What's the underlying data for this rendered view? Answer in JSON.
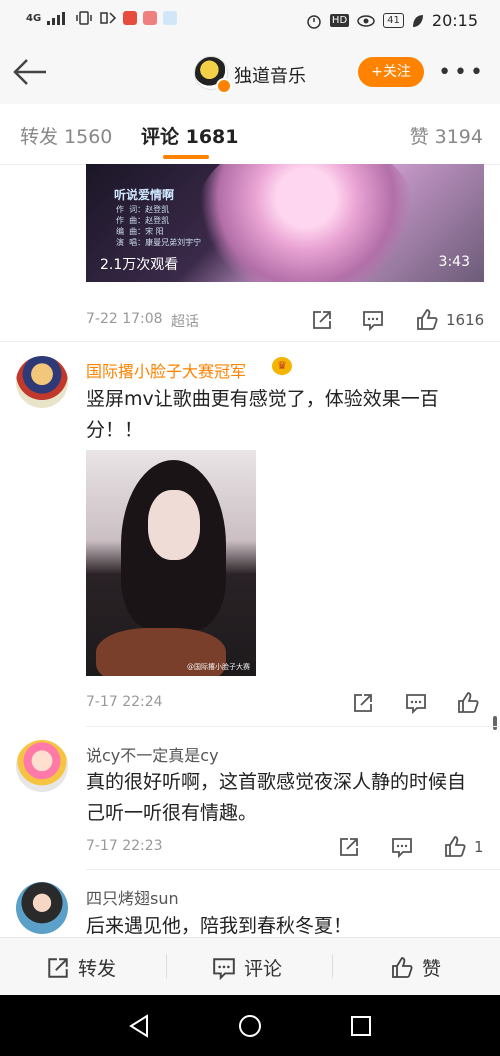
{
  "status_bar": {
    "network": "4G",
    "signal_icon": "signal-icon",
    "time": "20:15",
    "battery": "41",
    "hd_label": "HD"
  },
  "header": {
    "account_name": "独道音乐",
    "follow_label": "+关注",
    "more_label": "•••"
  },
  "tabs": {
    "repost": "转发 1560",
    "comment": "评论 1681",
    "like": "赞 3194"
  },
  "video": {
    "title": "听说爱情啊",
    "credits": "作  词：赵登凯\n作  曲：赵登凯\n编  曲：宋 阳\n演  唱：康曼兄弟刘宇宁",
    "views": "2.1万次观看",
    "duration": "3:43"
  },
  "post_meta": {
    "time": "7-22 17:08",
    "source": "超话",
    "like_count": "1616"
  },
  "comments": [
    {
      "username": "国际撂小脸子大赛冠军",
      "text": "竖屏mv让歌曲更有感觉了，体验效果一百分！！",
      "photo_watermark": "@国际撂小脸子大赛",
      "time": "7-17 22:24",
      "likes": ""
    },
    {
      "username": "说cy不一定真是cy",
      "text": "真的很好听啊，这首歌感觉夜深人静的时候自己听一听很有情趣。",
      "time": "7-17 22:23",
      "likes": "1"
    },
    {
      "username": "四只烤翅sun",
      "text": "后来遇见他，陪我到春秋冬夏！",
      "time": "",
      "likes": ""
    }
  ],
  "bottom_bar": {
    "repost": "转发",
    "comment": "评论",
    "like": "赞"
  },
  "colors": {
    "accent": "#ff8200",
    "text": "#222222",
    "meta": "#999999"
  }
}
